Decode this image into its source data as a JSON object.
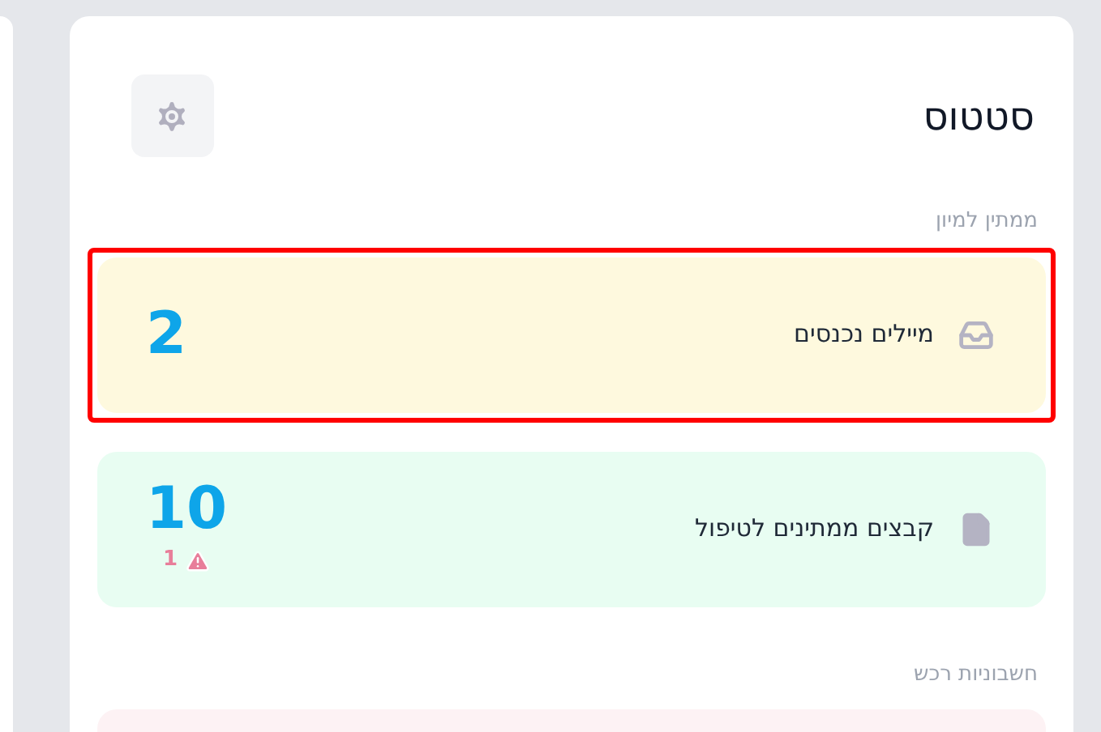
{
  "title": "סטטוס",
  "sections": [
    {
      "label": "ממתין למיון",
      "items": [
        {
          "kind": "inbox",
          "label": "מיילים נכנסים",
          "count": "2",
          "color": "#fef9de",
          "highlighted": true
        },
        {
          "kind": "file",
          "label": "קבצים ממתינים לטיפול",
          "count": "10",
          "warning": "1",
          "color": "#e8fdf2",
          "highlighted": false
        }
      ]
    },
    {
      "label": "חשבוניות רכש",
      "items": [
        {
          "kind": "blank",
          "color": "#fdf2f4",
          "highlighted": false
        }
      ]
    }
  ]
}
